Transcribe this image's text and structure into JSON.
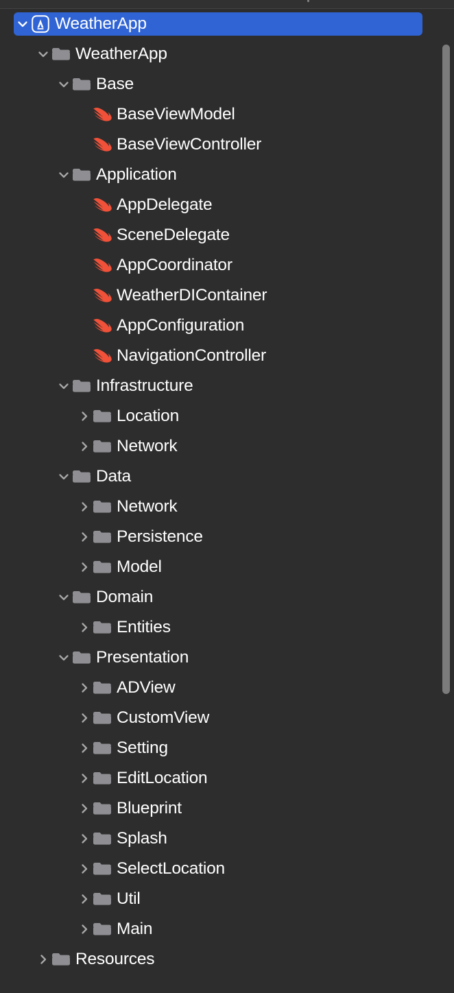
{
  "window": {
    "title": "Project Navigator",
    "background_color": "#2d2d2d",
    "selection_color": "#3064d4",
    "text_color": "#ffffff",
    "folder_icon_color": "#8e8e93",
    "swift_icon_color": "#f05138"
  },
  "scrollbar": {
    "orientation": "vertical",
    "thumb_color": "#7b7b7b"
  },
  "tree": {
    "items": [
      {
        "label": "WeatherApp",
        "depth": 0,
        "icon": "xcode-project-icon",
        "twisty": "down",
        "selected": true
      },
      {
        "label": "WeatherApp",
        "depth": 1,
        "icon": "folder-icon",
        "twisty": "down",
        "selected": false
      },
      {
        "label": "Base",
        "depth": 2,
        "icon": "folder-icon",
        "twisty": "down",
        "selected": false
      },
      {
        "label": "BaseViewModel",
        "depth": 3,
        "icon": "swift-file-icon",
        "twisty": "none",
        "selected": false
      },
      {
        "label": "BaseViewController",
        "depth": 3,
        "icon": "swift-file-icon",
        "twisty": "none",
        "selected": false
      },
      {
        "label": "Application",
        "depth": 2,
        "icon": "folder-icon",
        "twisty": "down",
        "selected": false
      },
      {
        "label": "AppDelegate",
        "depth": 3,
        "icon": "swift-file-icon",
        "twisty": "none",
        "selected": false
      },
      {
        "label": "SceneDelegate",
        "depth": 3,
        "icon": "swift-file-icon",
        "twisty": "none",
        "selected": false
      },
      {
        "label": "AppCoordinator",
        "depth": 3,
        "icon": "swift-file-icon",
        "twisty": "none",
        "selected": false
      },
      {
        "label": "WeatherDIContainer",
        "depth": 3,
        "icon": "swift-file-icon",
        "twisty": "none",
        "selected": false
      },
      {
        "label": "AppConfiguration",
        "depth": 3,
        "icon": "swift-file-icon",
        "twisty": "none",
        "selected": false
      },
      {
        "label": "NavigationController",
        "depth": 3,
        "icon": "swift-file-icon",
        "twisty": "none",
        "selected": false
      },
      {
        "label": "Infrastructure",
        "depth": 2,
        "icon": "folder-icon",
        "twisty": "down",
        "selected": false
      },
      {
        "label": "Location",
        "depth": 3,
        "icon": "folder-icon",
        "twisty": "right",
        "selected": false
      },
      {
        "label": "Network",
        "depth": 3,
        "icon": "folder-icon",
        "twisty": "right",
        "selected": false
      },
      {
        "label": "Data",
        "depth": 2,
        "icon": "folder-icon",
        "twisty": "down",
        "selected": false
      },
      {
        "label": "Network",
        "depth": 3,
        "icon": "folder-icon",
        "twisty": "right",
        "selected": false
      },
      {
        "label": "Persistence",
        "depth": 3,
        "icon": "folder-icon",
        "twisty": "right",
        "selected": false
      },
      {
        "label": "Model",
        "depth": 3,
        "icon": "folder-icon",
        "twisty": "right",
        "selected": false
      },
      {
        "label": "Domain",
        "depth": 2,
        "icon": "folder-icon",
        "twisty": "down",
        "selected": false
      },
      {
        "label": "Entities",
        "depth": 3,
        "icon": "folder-icon",
        "twisty": "right",
        "selected": false
      },
      {
        "label": "Presentation",
        "depth": 2,
        "icon": "folder-icon",
        "twisty": "down",
        "selected": false
      },
      {
        "label": "ADView",
        "depth": 3,
        "icon": "folder-icon",
        "twisty": "right",
        "selected": false
      },
      {
        "label": "CustomView",
        "depth": 3,
        "icon": "folder-icon",
        "twisty": "right",
        "selected": false
      },
      {
        "label": "Setting",
        "depth": 3,
        "icon": "folder-icon",
        "twisty": "right",
        "selected": false
      },
      {
        "label": "EditLocation",
        "depth": 3,
        "icon": "folder-icon",
        "twisty": "right",
        "selected": false
      },
      {
        "label": "Blueprint",
        "depth": 3,
        "icon": "folder-icon",
        "twisty": "right",
        "selected": false
      },
      {
        "label": "Splash",
        "depth": 3,
        "icon": "folder-icon",
        "twisty": "right",
        "selected": false
      },
      {
        "label": "SelectLocation",
        "depth": 3,
        "icon": "folder-icon",
        "twisty": "right",
        "selected": false
      },
      {
        "label": "Util",
        "depth": 3,
        "icon": "folder-icon",
        "twisty": "right",
        "selected": false
      },
      {
        "label": "Main",
        "depth": 3,
        "icon": "folder-icon",
        "twisty": "right",
        "selected": false
      },
      {
        "label": "Resources",
        "depth": 1,
        "icon": "folder-icon",
        "twisty": "right",
        "selected": false
      }
    ]
  }
}
